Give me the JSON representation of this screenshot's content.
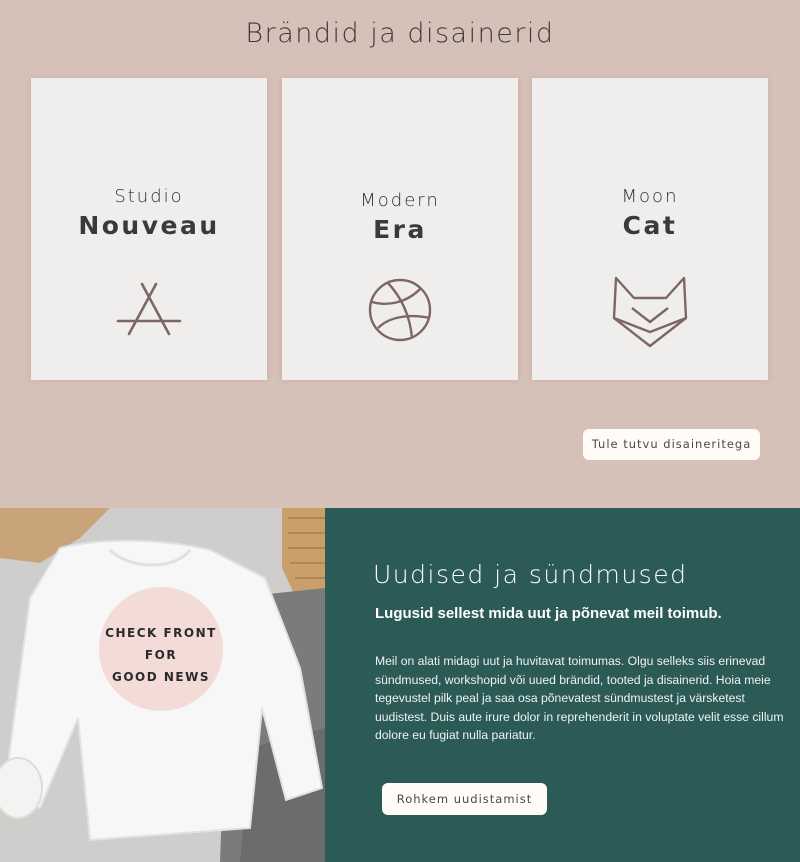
{
  "brands": {
    "title": "Brändid ja disainerid",
    "cards": [
      {
        "sub": "Studio",
        "main": "Nouveau",
        "icon": "app-store-icon"
      },
      {
        "sub": "Modern",
        "main": "Era",
        "icon": "basketball-icon"
      },
      {
        "sub": "Moon",
        "main": "Cat",
        "icon": "cat-fox-icon"
      }
    ],
    "cta": "Tule tutvu disaineritega"
  },
  "photo": {
    "circle_line1": "CHECK FRONT",
    "circle_line2": "FOR",
    "circle_line3": "GOOD NEWS"
  },
  "news": {
    "title": "Uudised ja sündmused",
    "subtitle": "Lugusid sellest mida uut ja põnevat meil toimub.",
    "body": "Meil on alati midagi uut ja huvitavat toimumas. Olgu selleks siis erinevad sündmused, workshopid või uued brändid, tooted ja disainerid. Hoia meie tegevustel pilk peal ja saa osa põnevatest sündmustest ja värsketest uudistest. Duis aute irure dolor in reprehenderit in voluptate velit esse cillum dolore eu fugiat nulla pariatur.",
    "cta": "Rohkem uudistamist"
  },
  "colors": {
    "brands_bg": "#d6c1b8",
    "card_bg": "#efeeed",
    "icon_stroke": "#7d6663",
    "news_bg": "#2c5a57",
    "circle": "#f3dbd8"
  }
}
